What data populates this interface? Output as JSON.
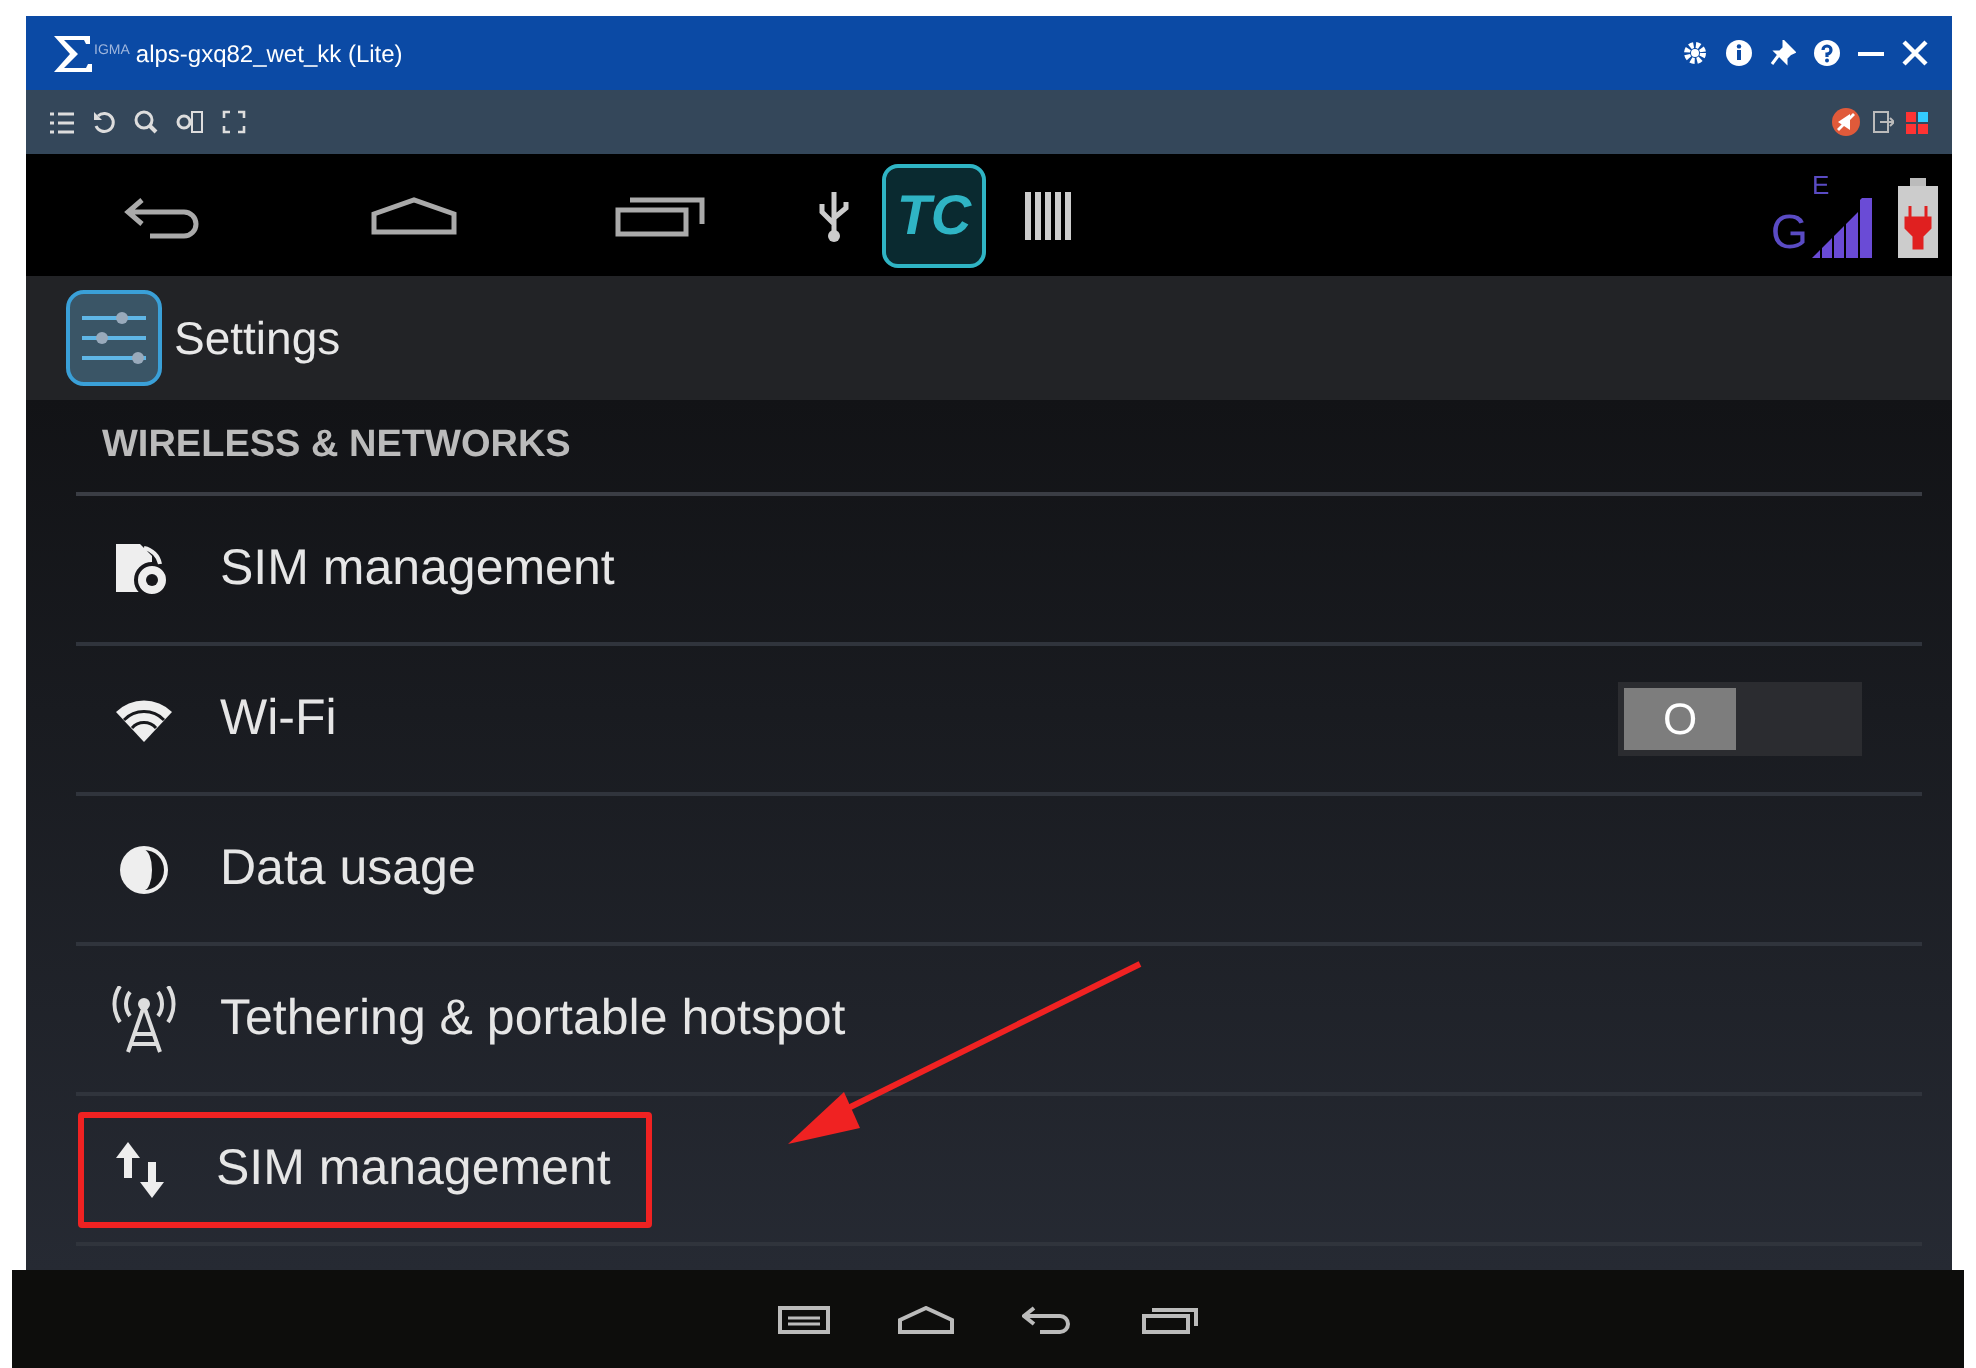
{
  "window": {
    "title": "alps-gxq82_wet_kk (Lite)",
    "logo_text": "IGMA"
  },
  "status_bar": {
    "app_badge": "TC",
    "network_type": "G",
    "data_type": "E"
  },
  "action_bar": {
    "title": "Settings"
  },
  "section": {
    "header": "WIRELESS & NETWORKS"
  },
  "items": [
    {
      "kind": "link",
      "label": "SIM management",
      "highlighted": false
    },
    {
      "kind": "switch",
      "label": "Wi-Fi",
      "on": false,
      "switch_text": "O",
      "highlighted": false
    },
    {
      "kind": "link",
      "label": "Data usage",
      "highlighted": false
    },
    {
      "kind": "link",
      "label": "Tethering & portable hotspot",
      "highlighted": false
    },
    {
      "kind": "link",
      "label": "SIM management",
      "highlighted": true
    }
  ]
}
